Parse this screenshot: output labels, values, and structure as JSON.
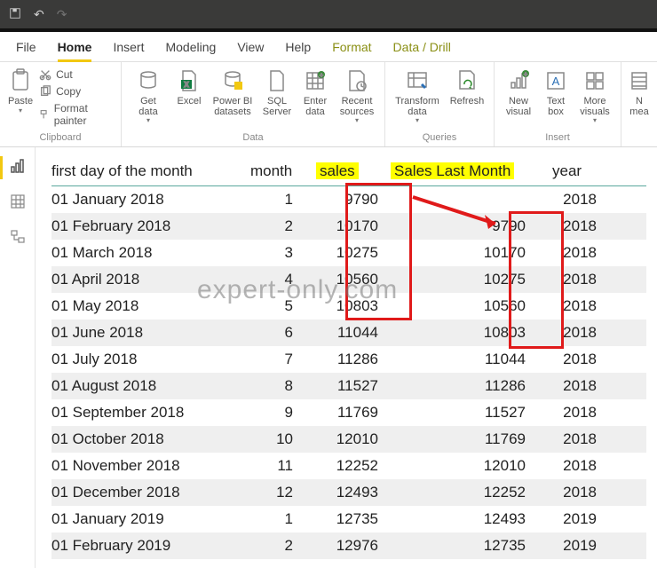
{
  "menu": {
    "file": "File",
    "tabs": [
      "Home",
      "Insert",
      "Modeling",
      "View",
      "Help",
      "Format",
      "Data / Drill"
    ]
  },
  "ribbon": {
    "clipboard": {
      "paste": "Paste",
      "cut": "Cut",
      "copy": "Copy",
      "format_painter": "Format painter",
      "group": "Clipboard"
    },
    "data_group": {
      "get_data": "Get\ndata",
      "excel": "Excel",
      "pbi_ds": "Power BI\ndatasets",
      "sql": "SQL\nServer",
      "enter": "Enter\ndata",
      "recent": "Recent\nsources",
      "group": "Data"
    },
    "queries": {
      "transform": "Transform\ndata",
      "refresh": "Refresh",
      "group": "Queries"
    },
    "insert": {
      "new_visual": "New\nvisual",
      "text_box": "Text\nbox",
      "more": "More\nvisuals",
      "group": "Insert"
    },
    "mea": {
      "label": "N\nmea"
    }
  },
  "table": {
    "headers": {
      "c1": "first day of the month",
      "c2": "month",
      "c3": "sales",
      "c4": "Sales Last Month",
      "c5": "year"
    },
    "rows": [
      {
        "c1": "01 January 2018",
        "c2": "1",
        "c3": "9790",
        "c4": "",
        "c5": "2018"
      },
      {
        "c1": "01 February 2018",
        "c2": "2",
        "c3": "10170",
        "c4": "9790",
        "c5": "2018"
      },
      {
        "c1": "01 March 2018",
        "c2": "3",
        "c3": "10275",
        "c4": "10170",
        "c5": "2018"
      },
      {
        "c1": "01 April 2018",
        "c2": "4",
        "c3": "10560",
        "c4": "10275",
        "c5": "2018"
      },
      {
        "c1": "01 May 2018",
        "c2": "5",
        "c3": "10803",
        "c4": "10560",
        "c5": "2018"
      },
      {
        "c1": "01 June 2018",
        "c2": "6",
        "c3": "11044",
        "c4": "10803",
        "c5": "2018"
      },
      {
        "c1": "01 July 2018",
        "c2": "7",
        "c3": "11286",
        "c4": "11044",
        "c5": "2018"
      },
      {
        "c1": "01 August 2018",
        "c2": "8",
        "c3": "11527",
        "c4": "11286",
        "c5": "2018"
      },
      {
        "c1": "01 September 2018",
        "c2": "9",
        "c3": "11769",
        "c4": "11527",
        "c5": "2018"
      },
      {
        "c1": "01 October 2018",
        "c2": "10",
        "c3": "12010",
        "c4": "11769",
        "c5": "2018"
      },
      {
        "c1": "01 November 2018",
        "c2": "11",
        "c3": "12252",
        "c4": "12010",
        "c5": "2018"
      },
      {
        "c1": "01 December 2018",
        "c2": "12",
        "c3": "12493",
        "c4": "12252",
        "c5": "2018"
      },
      {
        "c1": "01 January 2019",
        "c2": "1",
        "c3": "12735",
        "c4": "12493",
        "c5": "2019"
      },
      {
        "c1": "01 February 2019",
        "c2": "2",
        "c3": "12976",
        "c4": "12735",
        "c5": "2019"
      }
    ]
  },
  "watermark": "expert-only.com"
}
